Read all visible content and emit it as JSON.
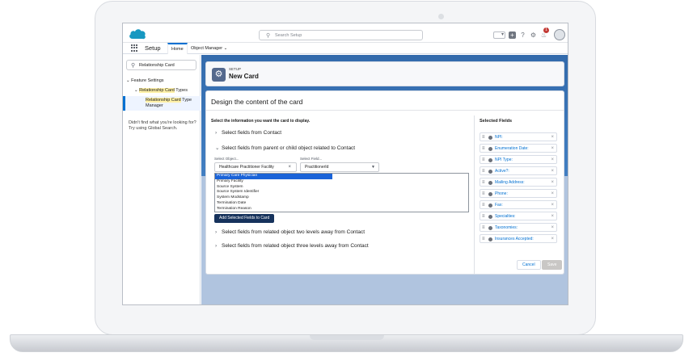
{
  "header": {
    "search_placeholder": "Search Setup",
    "notification_count": "1"
  },
  "nav": {
    "app_name": "Setup",
    "tabs": [
      {
        "label": "Home"
      },
      {
        "label": "Object Manager"
      }
    ]
  },
  "sidebar": {
    "search_value": "Relationship Card",
    "feature_settings": "Feature Settings",
    "types_hl": "Relationship Card",
    "types_rest": " Types",
    "manager_hl": "Relationship Card",
    "manager_rest": " Type Manager",
    "not_found": "Didn't find what you're looking for? Try using Global Search."
  },
  "page": {
    "setup_label": "SETUP",
    "title": "New Card"
  },
  "card": {
    "title": "Design the content of the card",
    "instruction": "Select the information you want the card to display.",
    "sections": [
      {
        "label": "Select fields from Contact",
        "expanded": false
      },
      {
        "label": "Select fields from parent or child object related to Contact",
        "expanded": true
      },
      {
        "label": "Select fields from related object two levels away from Contact",
        "expanded": false
      },
      {
        "label": "Select fields from related object three levels away from Contact",
        "expanded": false
      }
    ],
    "select_object_label": "Select Object...",
    "select_object_value": "Healthcare Practitioner Facility",
    "select_field_label": "Select Field...",
    "select_field_value": "PractitionerId",
    "options": [
      "Primary Care Physician",
      "Primary Facility",
      "Source System",
      "Source System Identifier",
      "System Modstamp",
      "Termination Date",
      "Termination Reason"
    ],
    "add_button": "Add Selected Fields to Card",
    "selected_title": "Selected Fields",
    "selected_fields": [
      "NPI:",
      "Enumeration Date:",
      "NPI Type:",
      "Active?:",
      "Mailing Address:",
      "Phone:",
      "Fax:",
      "Specialties:",
      "Taxonomies:",
      "Insurances Accepted:"
    ],
    "cancel": "Cancel",
    "save": "Save"
  }
}
